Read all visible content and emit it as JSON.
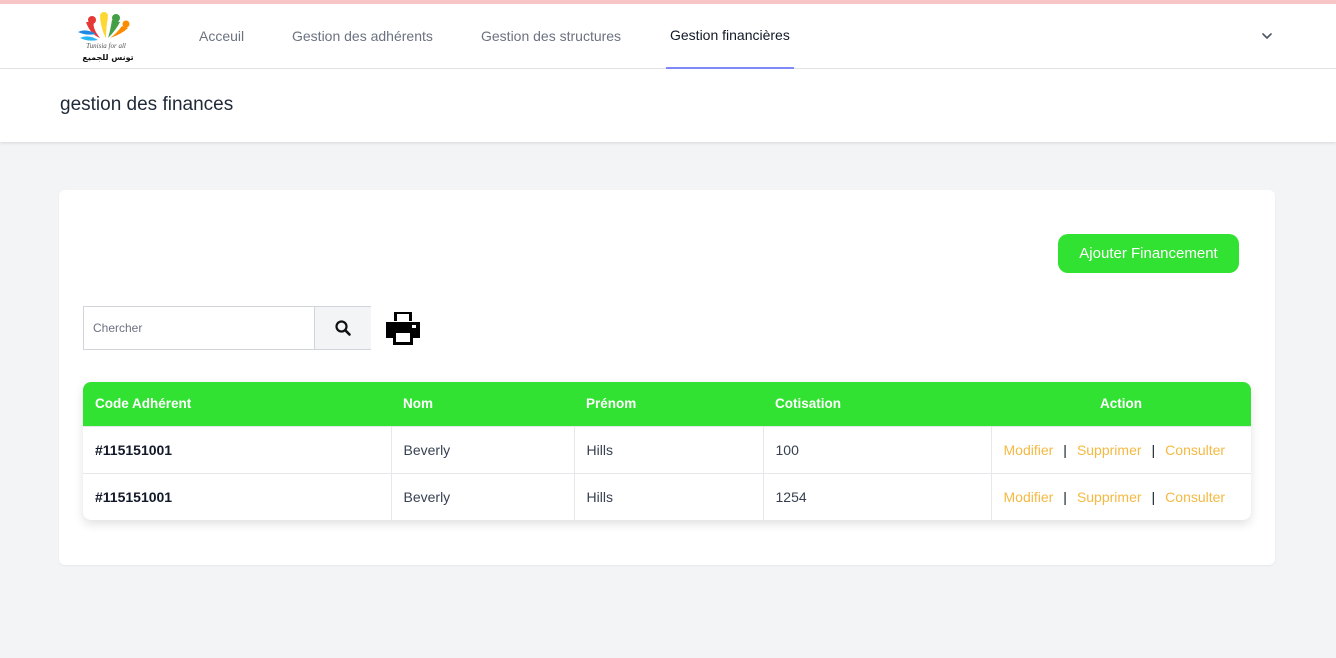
{
  "nav": {
    "logo_alt": "Tunisia for all",
    "items": [
      {
        "label": "Acceuil"
      },
      {
        "label": "Gestion des adhérents"
      },
      {
        "label": "Gestion des structures"
      },
      {
        "label": "Gestion financières"
      }
    ],
    "active_index": 3
  },
  "header": {
    "title": "gestion des finances"
  },
  "toolbar": {
    "add_label": "Ajouter Financement",
    "search_placeholder": "Chercher",
    "search_value": ""
  },
  "table": {
    "headers": [
      "Code Adhérent",
      "Nom",
      "Prénom",
      "Cotisation",
      "Action"
    ],
    "rows": [
      {
        "code": "#115151001",
        "nom": "Beverly",
        "prenom": "Hills",
        "cotisation": "100"
      },
      {
        "code": "#115151001",
        "nom": "Beverly",
        "prenom": "Hills",
        "cotisation": "1254"
      }
    ],
    "actions": {
      "modify": "Modifier",
      "delete": "Supprimer",
      "view": "Consulter",
      "separator": "|"
    }
  },
  "colors": {
    "accent_green": "#32e232",
    "action_orange": "#f5b942",
    "active_tab_underline": "#818cf8"
  },
  "icons": [
    "logo",
    "chevron-down-icon",
    "search-icon",
    "printer-icon"
  ]
}
